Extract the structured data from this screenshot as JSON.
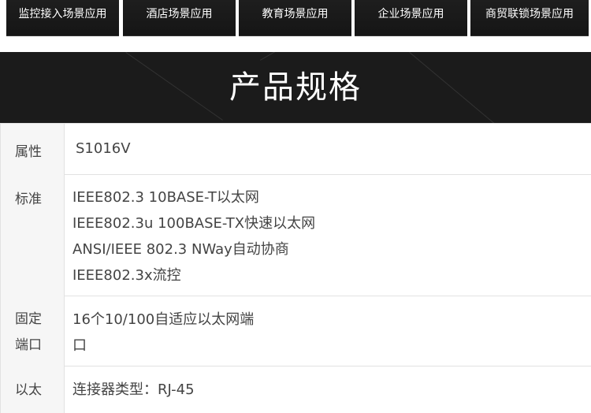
{
  "tabs": [
    "监控接入场景应用",
    "酒店场景应用",
    "教育场景应用",
    "企业场景应用",
    "商贸联锁场景应用"
  ],
  "banner": {
    "title": "产品规格"
  },
  "specs": [
    {
      "label": [
        "属性"
      ],
      "values": [
        "S1016V"
      ]
    },
    {
      "label": [
        "标准"
      ],
      "values": [
        "IEEE802.3 10BASE-T以太网",
        "IEEE802.3u 100BASE-TX快速以太网",
        "ANSI/IEEE 802.3 NWay自动协商",
        "IEEE802.3x流控"
      ]
    },
    {
      "label": [
        "固定",
        "端口"
      ],
      "values": [
        "16个10/100自适应以太网端",
        "口"
      ]
    },
    {
      "label": [
        "以太"
      ],
      "values": [
        "连接器类型：RJ-45"
      ]
    }
  ]
}
